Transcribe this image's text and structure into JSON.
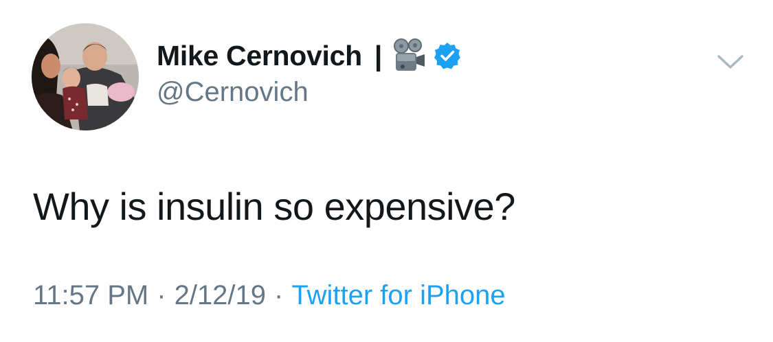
{
  "author": {
    "display_name": "Mike Cernovich",
    "name_separator": "|",
    "name_emoji": "film-projector-icon",
    "verified": true,
    "handle": "@Cernovich"
  },
  "tweet": {
    "text": "Why is insulin so expensive?",
    "time": "11:57 PM",
    "separator": "·",
    "date": "2/12/19",
    "source": "Twitter for iPhone"
  },
  "colors": {
    "text_primary": "#14171a",
    "text_secondary": "#657786",
    "link": "#1da1f2",
    "verified_badge": "#1da1f2",
    "caret": "#aab8c2"
  },
  "icons": {
    "more_menu": "chevron-down-icon",
    "verified": "verified-badge-icon"
  }
}
